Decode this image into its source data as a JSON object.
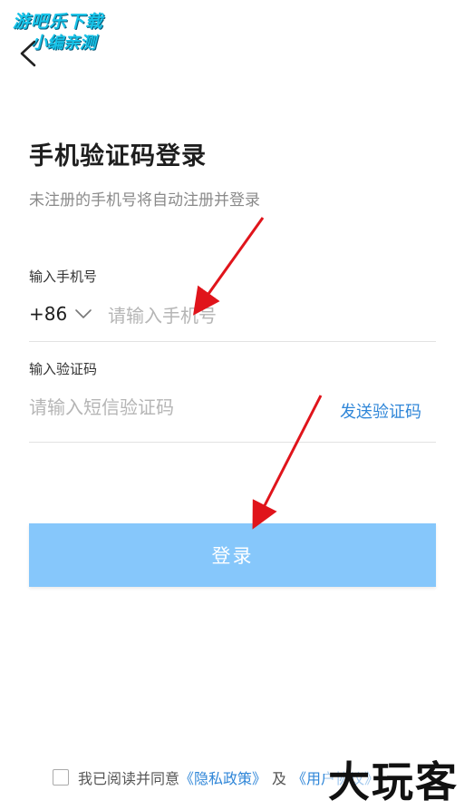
{
  "watermark_top": {
    "line1": "游吧乐下载",
    "line2": "小编亲测"
  },
  "header": {
    "back_icon": "chevron-left-icon"
  },
  "title": "手机验证码登录",
  "subtitle": "未注册的手机号将自动注册并登录",
  "phone_field": {
    "label": "输入手机号",
    "country_code": "+86",
    "placeholder": "请输入手机号",
    "value": ""
  },
  "code_field": {
    "label": "输入验证码",
    "placeholder": "请输入短信验证码",
    "value": "",
    "send_code_label": "发送验证码"
  },
  "login_button": {
    "label": "登录",
    "color": "#86c7fb"
  },
  "agreement": {
    "checked": false,
    "prefix": "我已阅读并同意",
    "privacy_link": "《隐私政策》",
    "conjunction": "及",
    "terms_link": "《用户协议》"
  },
  "watermark_bottom": "大玩客",
  "colors": {
    "accent": "#2f86d8",
    "annotation_arrow": "#e0141b"
  }
}
